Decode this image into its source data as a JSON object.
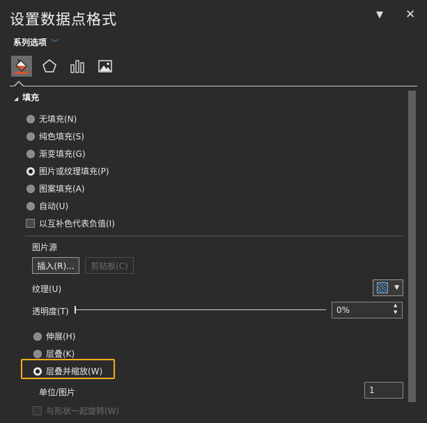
{
  "panel": {
    "title": "设置数据点格式",
    "series_options_label": "系列选项"
  },
  "tabs": [
    {
      "name": "fill-line",
      "icon": "paint-bucket-icon",
      "selected": true
    },
    {
      "name": "effects",
      "icon": "pentagon-icon",
      "selected": false
    },
    {
      "name": "series-options",
      "icon": "bar-chart-icon",
      "selected": false
    },
    {
      "name": "picture",
      "icon": "picture-icon",
      "selected": false
    }
  ],
  "fill_section": {
    "heading": "填充",
    "options": [
      {
        "label": "无填充(N)",
        "selected": false
      },
      {
        "label": "纯色填充(S)",
        "selected": false
      },
      {
        "label": "渐变填充(G)",
        "selected": false
      },
      {
        "label": "图片或纹理填充(P)",
        "selected": true
      },
      {
        "label": "图案填充(A)",
        "selected": false
      },
      {
        "label": "自动(U)",
        "selected": false
      }
    ],
    "invert_label": "以互补色代表负值(I)"
  },
  "picture_source": {
    "label": "图片源",
    "insert_button": "插入(R)...",
    "clipboard_button": "剪贴板(C)"
  },
  "texture": {
    "label": "纹理(U)"
  },
  "transparency": {
    "label": "透明度(T)",
    "value": "0%",
    "level": 0
  },
  "tile_options": {
    "stretch": "伸展(H)",
    "stack": "层叠(K)",
    "stack_scale": "层叠并缩放(W)",
    "selected": "stack_scale"
  },
  "units": {
    "label": "单位/图片",
    "value": "1"
  },
  "rotate_with_shape": {
    "label": "与形状一起旋转(W)"
  },
  "colors": {
    "accent": "#4a9fe0",
    "highlight": "#f2b01e",
    "background": "#2b2b2b"
  }
}
